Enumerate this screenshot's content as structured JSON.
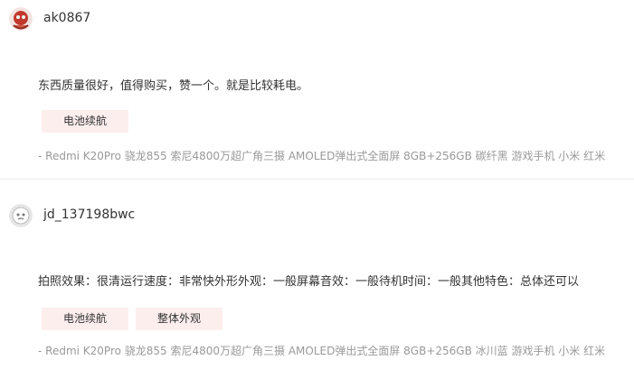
{
  "reviews": [
    {
      "username": "ak0867",
      "content": "东西质量很好，值得购买，赞一个。就是比较耗电。",
      "tags": [
        "电池续航"
      ],
      "product": "- Redmi K20Pro 骁龙855 索尼4800万超广角三摄 AMOLED弹出式全面屏 8GB+256GB 碳纤黑 游戏手机 小米 红米"
    },
    {
      "username": "jd_137198bwc",
      "content": "拍照效果：很清运行速度：非常快外形外观：一般屏幕音效：一般待机时间：一般其他特色：总体还可以",
      "tags": [
        "电池续航",
        "整体外观"
      ],
      "product": "- Redmi K20Pro 骁龙855 索尼4800万超广角三摄 AMOLED弹出式全面屏 8GB+256GB 冰川蓝 游戏手机 小米 红米"
    }
  ]
}
